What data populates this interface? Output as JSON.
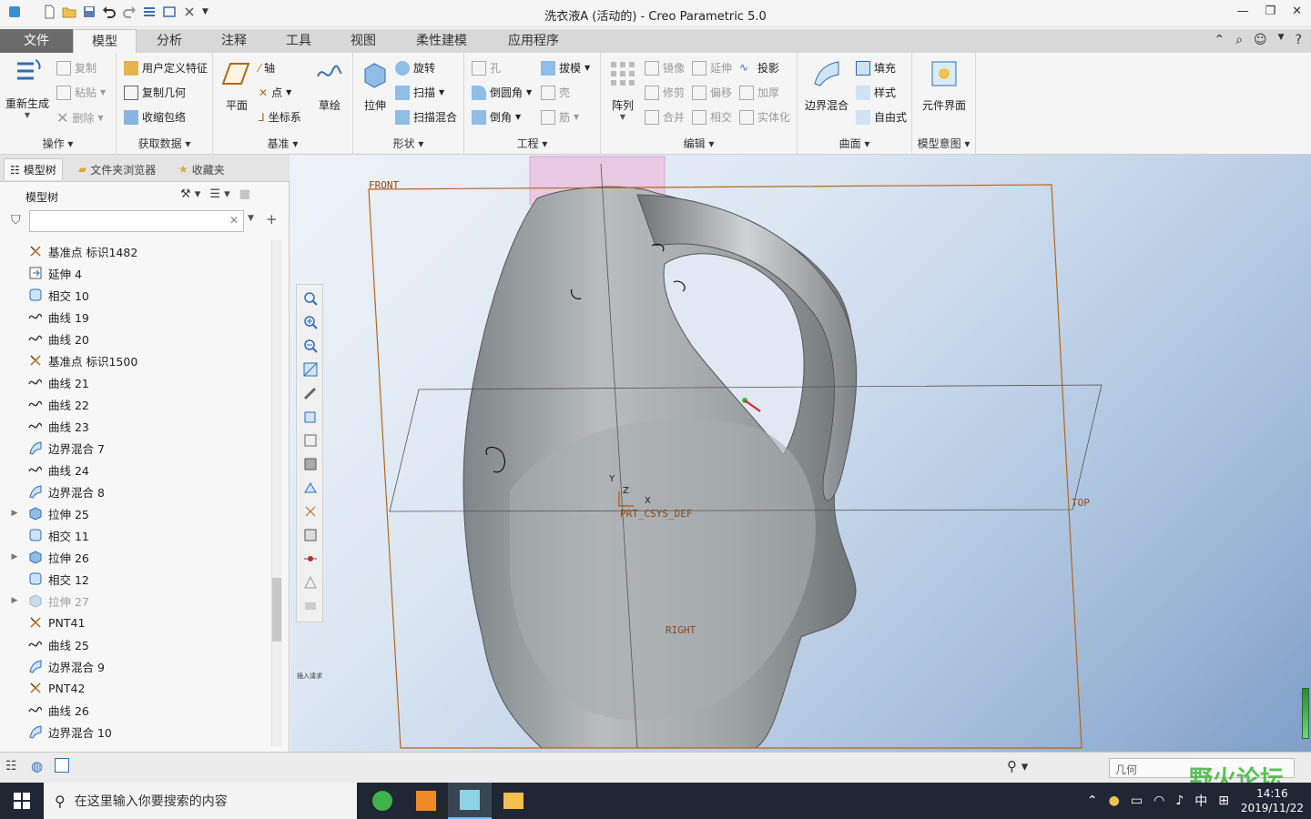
{
  "app": {
    "title": "洗衣液A (活动的) - Creo Parametric 5.0"
  },
  "tabs": [
    "文件",
    "模型",
    "分析",
    "注释",
    "工具",
    "视图",
    "柔性建模",
    "应用程序"
  ],
  "ribbon": {
    "operations": {
      "regenerate": "重新生成",
      "copy": "复制",
      "paste": "粘贴",
      "delete": "删除",
      "label": "操作"
    },
    "get_data": {
      "udf": "用户定义特征",
      "copy_geom": "复制几何",
      "shrinkwrap": "收缩包络",
      "label": "获取数据"
    },
    "datum": {
      "plane": "平面",
      "axis": "轴",
      "point": "点",
      "csys": "坐标系",
      "sketch": "草绘",
      "label": "基准"
    },
    "shapes": {
      "extrude": "拉伸",
      "revolve": "旋转",
      "sweep": "扫描",
      "swept_blend": "扫描混合",
      "label": "形状"
    },
    "engineering": {
      "hole": "孔",
      "draft": "拔模",
      "round": "倒圆角",
      "shell": "壳",
      "chamfer": "倒角",
      "rib": "筋",
      "label": "工程"
    },
    "editing": {
      "pattern": "阵列",
      "mirror": "镜像",
      "extend": "延伸",
      "project": "投影",
      "trim": "修剪",
      "offset": "偏移",
      "thicken": "加厚",
      "merge": "合并",
      "intersect": "相交",
      "solidify": "实体化",
      "label": "编辑"
    },
    "surfaces": {
      "boundary_blend": "边界混合",
      "fill": "填充",
      "style": "样式",
      "freestyle": "自由式",
      "label": "曲面"
    },
    "model_intent": {
      "component_interface": "元件界面",
      "label": "模型意图"
    }
  },
  "left_panel": {
    "tabs": [
      "模型树",
      "文件夹浏览器",
      "收藏夹"
    ],
    "title": "模型树",
    "filter_placeholder": "",
    "tree": [
      {
        "label": "基准点 标识1482",
        "icon": "datum-point",
        "expandable": false,
        "disabled": false
      },
      {
        "label": "延伸 4",
        "icon": "extend",
        "expandable": false,
        "disabled": false
      },
      {
        "label": "相交 10",
        "icon": "intersect",
        "expandable": false,
        "disabled": false
      },
      {
        "label": "曲线 19",
        "icon": "curve",
        "expandable": false,
        "disabled": false
      },
      {
        "label": "曲线 20",
        "icon": "curve",
        "expandable": false,
        "disabled": false
      },
      {
        "label": "基准点 标识1500",
        "icon": "datum-point",
        "expandable": false,
        "disabled": false
      },
      {
        "label": "曲线 21",
        "icon": "curve",
        "expandable": false,
        "disabled": false
      },
      {
        "label": "曲线 22",
        "icon": "curve",
        "expandable": false,
        "disabled": false
      },
      {
        "label": "曲线 23",
        "icon": "curve",
        "expandable": false,
        "disabled": false
      },
      {
        "label": "边界混合 7",
        "icon": "boundary-blend",
        "expandable": false,
        "disabled": false
      },
      {
        "label": "曲线 24",
        "icon": "curve",
        "expandable": false,
        "disabled": false
      },
      {
        "label": "边界混合 8",
        "icon": "boundary-blend",
        "expandable": false,
        "disabled": false
      },
      {
        "label": "拉伸 25",
        "icon": "extrude",
        "expandable": true,
        "disabled": false
      },
      {
        "label": "相交 11",
        "icon": "intersect",
        "expandable": false,
        "disabled": false
      },
      {
        "label": "拉伸 26",
        "icon": "extrude",
        "expandable": true,
        "disabled": false
      },
      {
        "label": "相交 12",
        "icon": "intersect",
        "expandable": false,
        "disabled": false
      },
      {
        "label": "拉伸 27",
        "icon": "extrude",
        "expandable": true,
        "disabled": true
      },
      {
        "label": "PNT41",
        "icon": "datum-point",
        "expandable": false,
        "disabled": false
      },
      {
        "label": "曲线 25",
        "icon": "curve",
        "expandable": false,
        "disabled": false
      },
      {
        "label": "边界混合 9",
        "icon": "boundary-blend",
        "expandable": false,
        "disabled": false
      },
      {
        "label": "PNT42",
        "icon": "datum-point",
        "expandable": false,
        "disabled": false
      },
      {
        "label": "曲线 26",
        "icon": "curve",
        "expandable": false,
        "disabled": false
      },
      {
        "label": "边界混合 10",
        "icon": "boundary-blend",
        "expandable": false,
        "disabled": false
      }
    ]
  },
  "viewport": {
    "plane_front": "FRONT",
    "plane_top": "TOP",
    "plane_right": "RIGHT",
    "csys_label": "PRT_CSYS_DEF",
    "axis_x": "X",
    "axis_y": "Y",
    "axis_z": "Z",
    "small_text": "插入请求"
  },
  "statusbar": {
    "selection_filter": "几何"
  },
  "taskbar": {
    "search_placeholder": "在这里输入你要搜索的内容",
    "ime": "中",
    "time": "14:16",
    "date": "2019/11/22"
  },
  "watermark": "野火论坛",
  "colors": {
    "accent": "#6b6b6b",
    "model_gray": "#9ea3a6",
    "datum_orange": "#b5651d",
    "bg_blue": "#a8c0dc"
  }
}
